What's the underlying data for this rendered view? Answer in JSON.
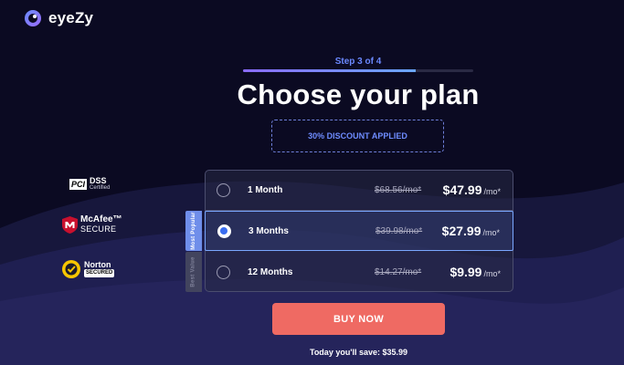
{
  "brand": {
    "name": "eyeZy"
  },
  "step": {
    "label": "Step 3 of 4",
    "progress_percent": 75
  },
  "title": "Choose your plan",
  "discount": "30% DISCOUNT APPLIED",
  "badges": {
    "pci": {
      "box": "PCI",
      "name": "DSS",
      "sub": "Certified"
    },
    "mcafee": {
      "name": "McAfee",
      "sub": "SECURE",
      "mark": "™"
    },
    "norton": {
      "name": "Norton",
      "sub": "SECURED"
    }
  },
  "plans": [
    {
      "name": "1 Month",
      "old_price": "$68.56/mo*",
      "price": "$47.99",
      "per": "/mo*",
      "selected": false,
      "ribbon": ""
    },
    {
      "name": "3 Months",
      "old_price": "$39.98/mo*",
      "price": "$27.99",
      "per": "/mo*",
      "selected": true,
      "ribbon": "Most Popular"
    },
    {
      "name": "12 Months",
      "old_price": "$14.27/mo*",
      "price": "$9.99",
      "per": "/mo*",
      "selected": false,
      "ribbon": "Best Value"
    }
  ],
  "cta": {
    "label": "BUY NOW"
  },
  "savings": "Today you'll save: $35.99",
  "colors": {
    "background": "#0b0a22",
    "accent": "#6e8cff",
    "cta": "#ef6a63",
    "selected_border": "#7aa7ff"
  }
}
